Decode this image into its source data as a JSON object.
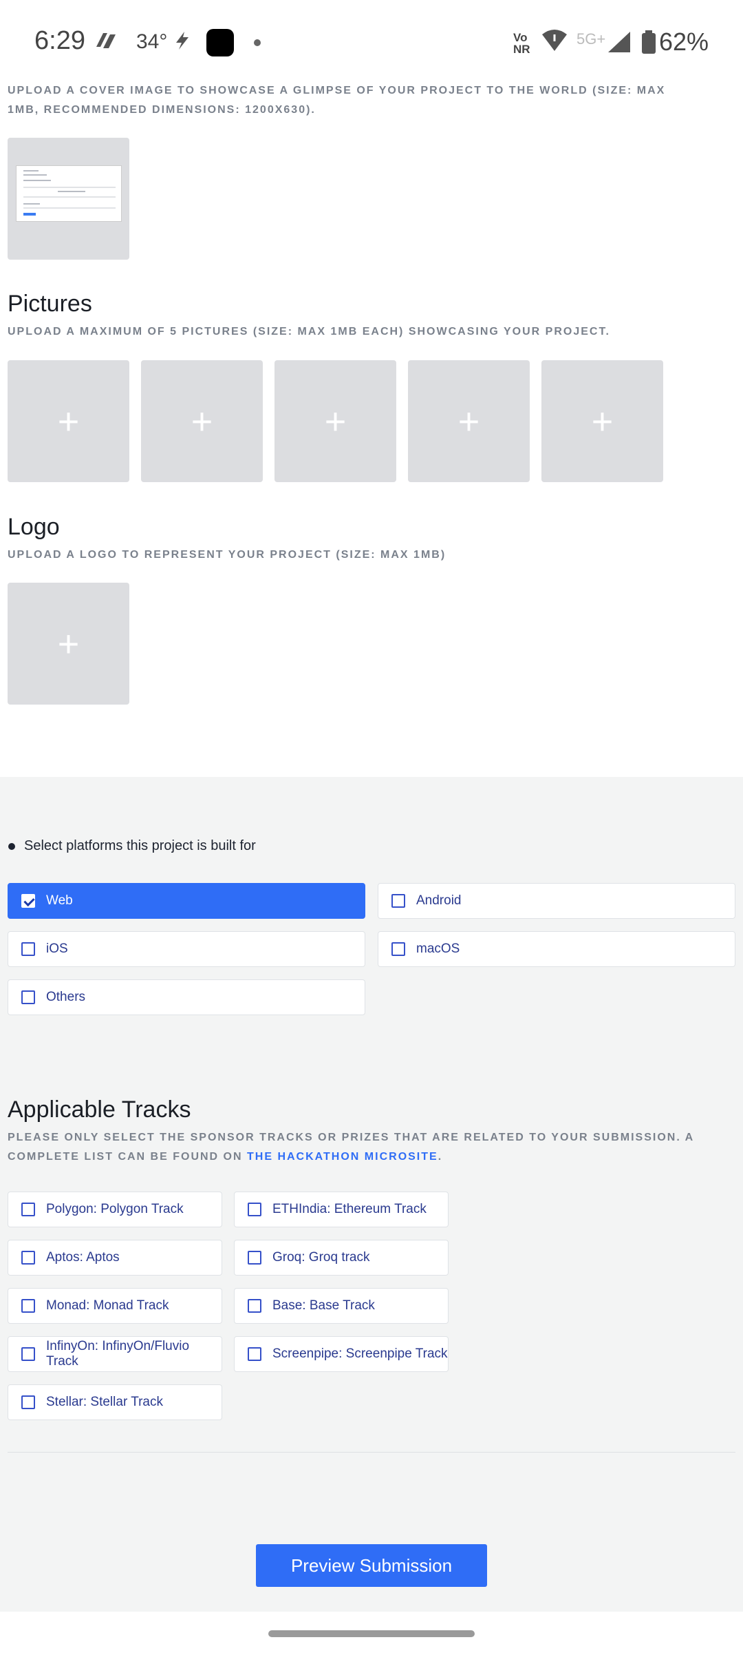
{
  "status_bar": {
    "time": "6:29",
    "temperature": "34°",
    "network_label_top": "Vo",
    "network_label_bottom": "NR",
    "network_5g": "5G+",
    "battery": "62%"
  },
  "cover": {
    "description": "Upload a cover image to showcase a glimpse of your project to the world (size: max 1MB, recommended dimensions: 1200x630)."
  },
  "pictures": {
    "title": "Pictures",
    "description": "Upload a maximum of 5 pictures (size: max 1MB each) showcasing your project.",
    "plus": "+"
  },
  "logo": {
    "title": "Logo",
    "description": "Upload a logo to represent your project (size: max 1MB)",
    "plus": "+"
  },
  "platforms": {
    "prompt": "Select platforms this project is built for",
    "options": [
      {
        "label": "Web",
        "checked": true
      },
      {
        "label": "Android",
        "checked": false
      },
      {
        "label": "iOS",
        "checked": false
      },
      {
        "label": "macOS",
        "checked": false
      },
      {
        "label": "Others",
        "checked": false
      }
    ]
  },
  "tracks": {
    "title": "Applicable Tracks",
    "description_prefix": "Please only select the sponsor tracks or prizes that are related to your submission. A complete list can be found on ",
    "link_text": "the hackathon microsite",
    "description_suffix": ".",
    "options": [
      {
        "label": "Polygon: Polygon Track",
        "checked": false
      },
      {
        "label": "ETHIndia: Ethereum Track",
        "checked": false
      },
      {
        "label": "Aptos: Aptos",
        "checked": false
      },
      {
        "label": "Groq: Groq track",
        "checked": false
      },
      {
        "label": "Monad: Monad Track",
        "checked": false
      },
      {
        "label": "Base: Base Track",
        "checked": false
      },
      {
        "label": "InfinyOn: InfinyOn/Fluvio Track",
        "checked": false
      },
      {
        "label": "Screenpipe: Screenpipe Track",
        "checked": false
      },
      {
        "label": "Stellar: Stellar Track",
        "checked": false
      }
    ]
  },
  "preview_button": "Preview Submission",
  "colors": {
    "accent": "#2f6df6",
    "grey_background": "#f3f4f4",
    "placeholder_tile": "#dcdde0"
  }
}
